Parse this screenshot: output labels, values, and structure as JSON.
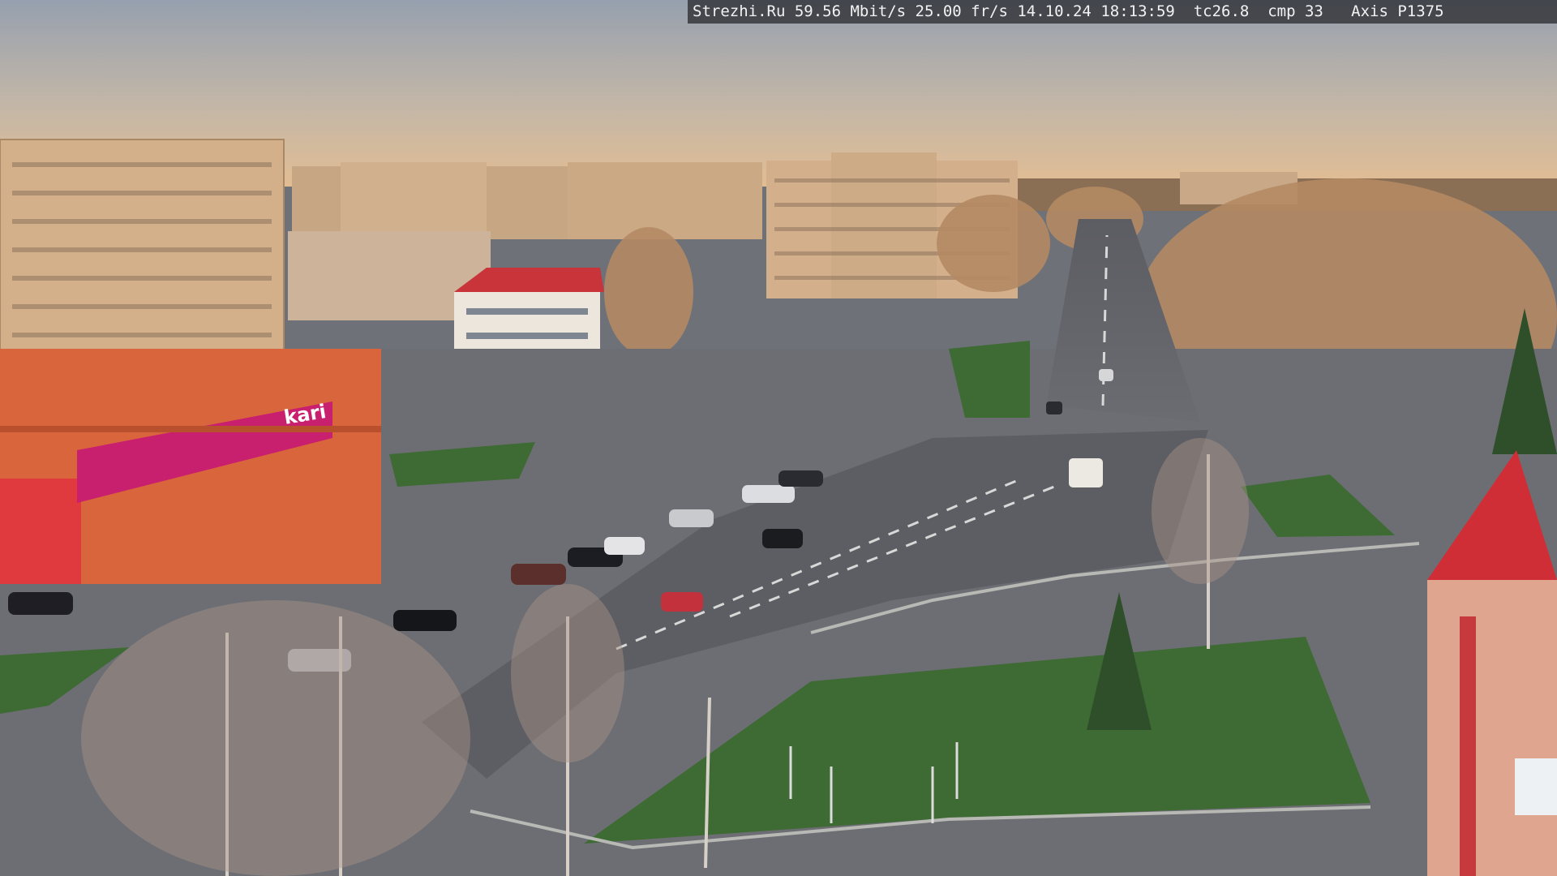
{
  "camera_overlay": {
    "text": "Strezhi.Ru 59.56 Mbit/s 25.00 fr/s 14.10.24 18:13:59  tc26.8  cmp 33   Axis P1375"
  },
  "signage": {
    "store_name": "kari"
  }
}
